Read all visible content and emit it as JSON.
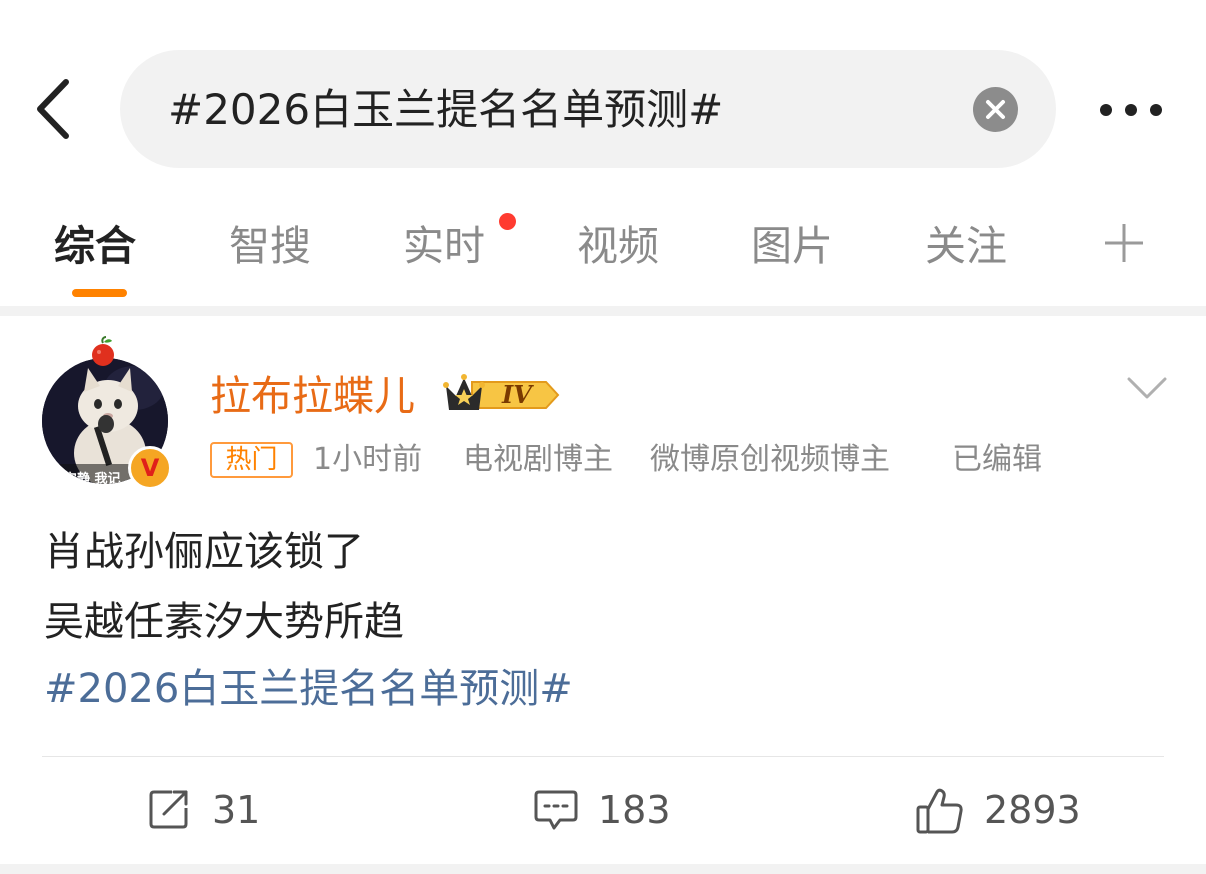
{
  "search": {
    "query": "#2026白玉兰提名名单预测#"
  },
  "tabs": [
    {
      "label": "综合",
      "active": true
    },
    {
      "label": "智搜",
      "active": false
    },
    {
      "label": "实时",
      "active": false,
      "has_dot": true
    },
    {
      "label": "视频",
      "active": false
    },
    {
      "label": "图片",
      "active": false
    },
    {
      "label": "关注",
      "active": false
    }
  ],
  "post": {
    "username": "拉布拉蝶儿",
    "vip_level": "IV",
    "avatar_caption": "安静 我记",
    "hot_tag": "热门",
    "time": "1小时前",
    "descriptor_1": "电视剧博主",
    "descriptor_2": "微博原创视频博主",
    "edited": "已编辑",
    "lines": [
      "肖战孙俪应该锁了",
      "吴越任素汐大势所趋"
    ],
    "topic": "#2026白玉兰提名名单预测#",
    "reposts": "31",
    "comments": "183",
    "likes": "2893"
  },
  "colors": {
    "accent_orange": "#ff8200",
    "username": "#e86b16",
    "topic_link": "#4c6d98",
    "notification_dot": "#ff3b30"
  },
  "icons": [
    "back-arrow-icon",
    "clear-icon",
    "more-icon",
    "plus-icon",
    "apple-icon",
    "verified-icon",
    "crown-icon",
    "chevron-down-icon",
    "repost-icon",
    "comment-icon",
    "like-icon"
  ]
}
